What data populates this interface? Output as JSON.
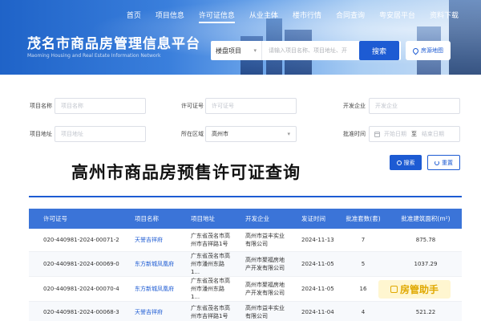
{
  "header": {
    "nav": [
      "首页",
      "项目信息",
      "许可证信息",
      "从业主体",
      "楼市行情",
      "合同查询",
      "粤安居平台",
      "资料下载"
    ],
    "active_nav": "许可证信息",
    "site_title": "茂名市商品房管理信息平台",
    "site_subtitle": "Maoming Housing and Real Estate Information Network",
    "search_type": "楼盘项目",
    "search_placeholder": "请输入项目名称、项目地址、开",
    "search_button": "搜索",
    "map_button": "房源地图"
  },
  "filters": {
    "project_name_label": "项目名称",
    "project_name_placeholder": "项目名称",
    "permit_no_label": "许可证号",
    "permit_no_placeholder": "许可证号",
    "developer_label": "开发企业",
    "developer_placeholder": "开发企业",
    "project_address_label": "项目地址",
    "project_address_placeholder": "项目地址",
    "region_label": "所在区域",
    "region_value": "高州市",
    "approval_time_label": "批准时间",
    "start_date_placeholder": "开始日期",
    "date_separator": "至",
    "end_date_placeholder": "结束日期",
    "query_button": "搜索",
    "reset_button": "重置"
  },
  "page_title": "高州市商品房预售许可证查询",
  "table": {
    "columns": [
      "许可证号",
      "项目名称",
      "项目地址",
      "开发企业",
      "发证时间",
      "批准套数(套)",
      "批准建筑面积(m²)"
    ],
    "rows": [
      [
        "020-440981-2024-00071-2",
        "天誉吉祥府",
        "广东省茂名市高州市吉祥路1号",
        "高州市益丰实业有限公司",
        "2024-11-13",
        "7",
        "875.78"
      ],
      [
        "020-440981-2024-00069-0",
        "东方新城凤凰府",
        "广东省茂名市高州市潘州东路1...",
        "高州市聚福房地产开发有限公司",
        "2024-11-05",
        "5",
        "1037.29"
      ],
      [
        "020-440981-2024-00070-4",
        "东方新城凤凰府",
        "广东省茂名市高州市潘州东路1...",
        "高州市聚福房地产开发有限公司",
        "2024-11-05",
        "16",
        ""
      ],
      [
        "020-440981-2024-00068-3",
        "天誉吉祥府",
        "广东省茂名市高州市吉祥路1号",
        "高州市益丰实业有限公司",
        "2024-11-04",
        "4",
        "521.22"
      ]
    ]
  },
  "watermark": "房管助手"
}
